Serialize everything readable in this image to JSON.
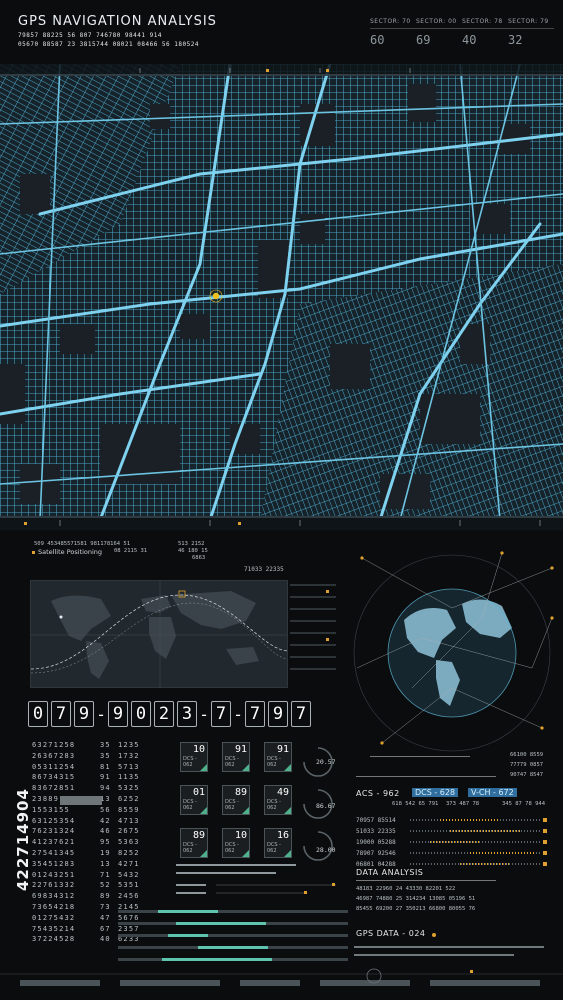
{
  "header": {
    "title": "GPS NAVIGATION ANALYSIS",
    "code_rows": [
      "79857  88225  56  807  746780  98441  914",
      "05670  88587  23  3815744   08021  08466  56  180524"
    ],
    "sectors": [
      {
        "label": "SECTOR: 70",
        "value": "60"
      },
      {
        "label": "SECTOR: 00",
        "value": "69"
      },
      {
        "label": "SECTOR: 78",
        "value": "40"
      },
      {
        "label": "SECTOR: 79",
        "value": "32"
      }
    ]
  },
  "satellite": {
    "title": "Satellite Positioning",
    "codes": [
      "509  453485571581  981178164 51",
      "08  2115  31",
      "513  2152",
      "46  180  15",
      "6863"
    ],
    "readout": "71033  22335"
  },
  "counter": {
    "digits": [
      "0",
      "7",
      "9",
      "-",
      "9",
      "0",
      "2",
      "3",
      "-",
      "7",
      "-",
      "7",
      "9",
      "7"
    ]
  },
  "numcols": {
    "col1": [
      "63271258",
      "26367283",
      "05311254",
      "86734315",
      "83672851",
      "23889",
      "1553155",
      "63125354",
      "76231324",
      "41237621",
      "27541345",
      "35451283",
      "01243251",
      "22761332",
      "69834312",
      "73654218",
      "01275432",
      "75435214",
      "37224528"
    ],
    "col2": [
      "35",
      "35",
      "81",
      "91",
      "94",
      "13",
      "56",
      "42",
      "46",
      "95",
      "19",
      "13",
      "71",
      "52",
      "89",
      "73",
      "47",
      "67",
      "40"
    ],
    "col3": [
      "1235",
      "1732",
      "5713",
      "1135",
      "5325",
      "6252",
      "8559",
      "4713",
      "2675",
      "5363",
      "8252",
      "4271",
      "5432",
      "5351",
      "2456",
      "2145",
      "5676",
      "2357",
      "6233"
    ]
  },
  "tiles": [
    {
      "value": "10",
      "label": "DCS - 062"
    },
    {
      "value": "91",
      "label": "DCS - 062"
    },
    {
      "value": "91",
      "label": "DCS - 062"
    },
    {
      "value": "01",
      "label": "DCS - 062"
    },
    {
      "value": "89",
      "label": "DCS - 062"
    },
    {
      "value": "49",
      "label": "DCS - 062"
    },
    {
      "value": "89",
      "label": "DCS - 062"
    },
    {
      "value": "10",
      "label": "DCS - 062"
    },
    {
      "value": "16",
      "label": "DCS - 062"
    }
  ],
  "gauges": [
    "20.57",
    "86.67",
    "28.00"
  ],
  "right": {
    "readouts": [
      "66100  8559",
      "77779  0857",
      "90747  8547"
    ],
    "acs": "ACS - 962",
    "dcs_hl": "DCS - 628",
    "vch_hl": "V-CH - 672",
    "acs_nums": "618 542 65  791",
    "vch_nums": "373 487 78",
    "tail_nums": "345 87 78  944",
    "data_rows": [
      "70957  85514",
      "51033  22335",
      "19000  05288",
      "78907  92546",
      "06801  04288"
    ],
    "data_analysis": "DATA ANALYSIS",
    "da_rows": [
      "48183  22960  24  43330  82201  522",
      "46987  74880  25  314234  13085  05196  51",
      "85455  69200  27  350213  66800  80055  76"
    ],
    "gps_data": "GPS DATA - 024"
  },
  "watermark": "422714904",
  "colors": {
    "street": "#5fb8d6",
    "block": "#1a2026",
    "accent": "#e0a030",
    "highlight": "#2f6e9e"
  }
}
